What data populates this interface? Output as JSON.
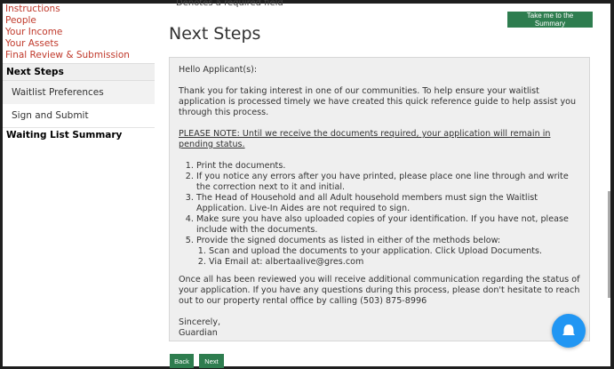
{
  "sidebar": {
    "links": [
      "Instructions",
      "People",
      "Your Income",
      "Your Assets",
      "Final Review & Submission"
    ],
    "next_steps": "Next Steps",
    "sub_items": [
      "Waitlist Preferences",
      "Sign and Submit"
    ],
    "waiting_list": "Waiting List Summary"
  },
  "header": {
    "required_note": "Denotes a required field",
    "summary_button": "Take me to the Summary",
    "title": "Next Steps"
  },
  "panel": {
    "greeting": "Hello Applicant(s):",
    "intro": "Thank you for taking interest in one of our communities. To help ensure your waitlist application is processed timely we have created this quick reference guide to help assist you through this process.",
    "note": "PLEASE NOTE: Until we receive the documents required, your application will remain in pending status.",
    "steps": [
      "Print the documents.",
      "If you notice any errors after you have printed, please place one line through and write the correction next to it and initial.",
      "The Head of Household and all Adult household members must sign the Waitlist Application. Live-In Aides are not required to sign.",
      "Make sure you have also uploaded copies of your identification. If you have not, please include with the documents.",
      "Provide the signed documents as listed in either of the methods below:"
    ],
    "methods": [
      "Scan and upload the documents to your application. Click Upload Documents.",
      "Via Email at: albertaalive@gres.com"
    ],
    "closing": "Once all has been reviewed you will receive additional communication regarding the status of your application. If you have any questions during this process, please don't hesitate to reach out to our property rental office by calling (503) 875-8996",
    "signoff": "Sincerely,",
    "signature": "Guardian"
  },
  "buttons": {
    "back": "Back",
    "next": "Next"
  },
  "colors": {
    "accent_green": "#2e7d4f",
    "link_red": "#c0392b",
    "fab_blue": "#2196f3"
  },
  "icons": {
    "fab": "bell-icon"
  }
}
